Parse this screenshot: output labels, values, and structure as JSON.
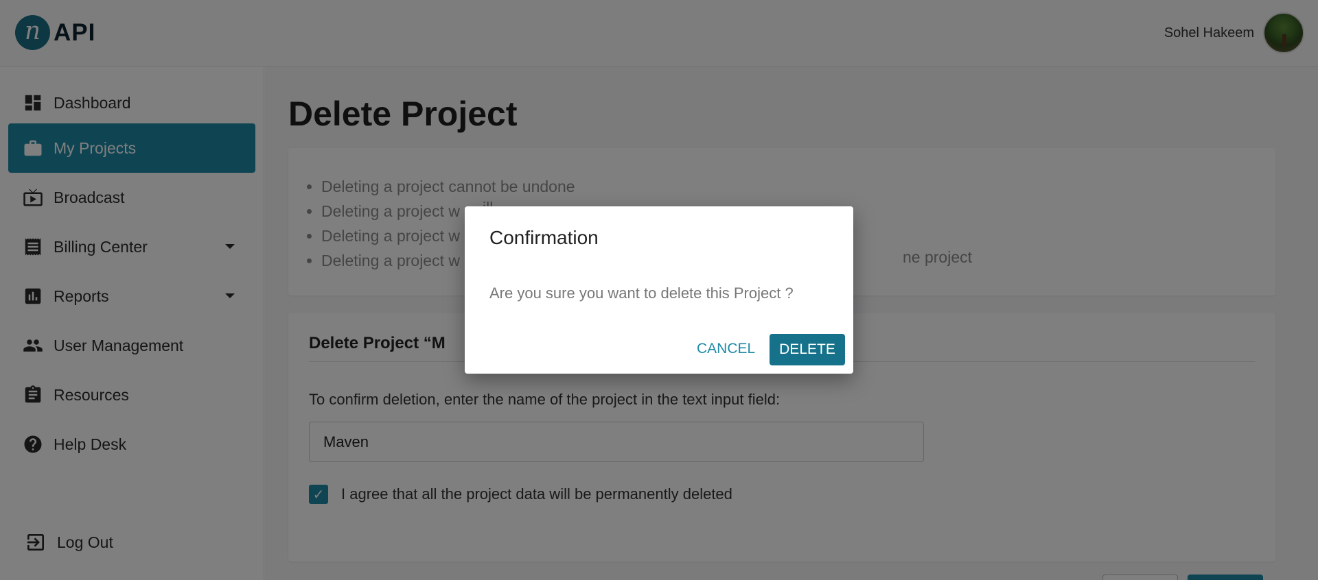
{
  "header": {
    "logo_mark": "n",
    "logo_text": "API",
    "user_name": "Sohel Hakeem"
  },
  "sidebar": {
    "items": [
      {
        "label": "Dashboard",
        "icon": "dashboard-icon"
      },
      {
        "label": "My Projects",
        "icon": "briefcase-icon",
        "active": true
      },
      {
        "label": "Broadcast",
        "icon": "tv-icon"
      },
      {
        "label": "Billing Center",
        "icon": "receipt-icon",
        "expandable": true
      },
      {
        "label": "Reports",
        "icon": "bar-chart-icon",
        "expandable": true
      },
      {
        "label": "User Management",
        "icon": "people-icon"
      },
      {
        "label": "Resources",
        "icon": "clipboard-icon"
      },
      {
        "label": "Help Desk",
        "icon": "help-icon"
      }
    ],
    "logout_label": "Log Out"
  },
  "main": {
    "title": "Delete Project",
    "warnings": [
      "Deleting a project cannot be undone",
      "Deleting a project w",
      "Deleting a project w",
      "Deleting a project w"
    ],
    "warning_tail": "ne project",
    "warning_fragment": "ill ...",
    "section_title": "Delete Project “M",
    "confirm_label": "To confirm deletion, enter the name of the project in the text input field:",
    "project_name_value": "Maven",
    "agree_label": "I agree that all the project data will be permanently deleted",
    "agree_checked": true
  },
  "dialog": {
    "title": "Confirmation",
    "message": "Are you sure you want to delete this Project ?",
    "cancel_label": "CANCEL",
    "delete_label": "DELETE"
  },
  "colors": {
    "accent": "#1e8aa6",
    "overlay": "rgba(0,0,0,0.5)"
  }
}
